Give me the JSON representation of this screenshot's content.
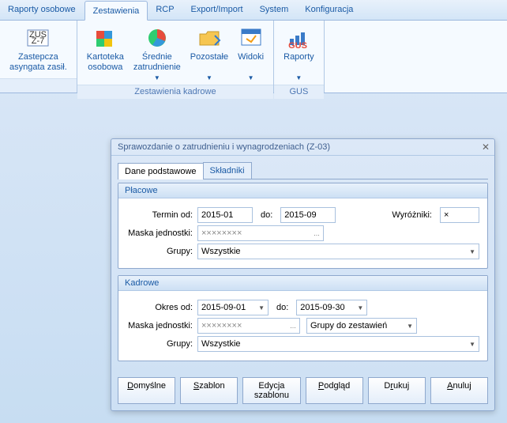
{
  "tabs": [
    "Raporty osobowe",
    "Zestawienia",
    "RCP",
    "Export/Import",
    "System",
    "Konfiguracja"
  ],
  "active_tab": 1,
  "ribbon": {
    "group1": {
      "label": "",
      "items": [
        {
          "label": "Zastepcza\nasyngata zasił."
        }
      ]
    },
    "group2": {
      "label": "Zestawienia kadrowe",
      "items": [
        {
          "label": "Kartoteka\nosobowa"
        },
        {
          "label": "Średnie\nzatrudnienie",
          "drop": true
        },
        {
          "label": "Pozostałe",
          "drop": true
        },
        {
          "label": "Widoki",
          "drop": true
        }
      ]
    },
    "group3": {
      "label": "GUS",
      "items": [
        {
          "label": "Raporty",
          "drop": true
        }
      ]
    }
  },
  "modal": {
    "title": "Sprawozdanie o zatrudnieniu i wynagrodzeniach (Z-03)",
    "tabs": [
      "Dane podstawowe",
      "Składniki"
    ],
    "active_tab": 0,
    "placowe": {
      "head": "Płacowe",
      "termin_od_label": "Termin od:",
      "termin_od": "2015-01",
      "do_label": "do:",
      "do": "2015-09",
      "wyrozniki_label": "Wyróżniki:",
      "wyrozniki": "×",
      "maska_label": "Maska jednostki:",
      "maska": "××××××××",
      "grupy_label": "Grupy:",
      "grupy": "Wszystkie"
    },
    "kadrowe": {
      "head": "Kadrowe",
      "okres_label": "Okres od:",
      "okres_od": "2015-09-01",
      "do_label": "do:",
      "okres_do": "2015-09-30",
      "maska_label": "Maska jednostki:",
      "maska": "××××××××",
      "grupy_do_label": "Grupy do zestawień",
      "grupy_label": "Grupy:",
      "grupy": "Wszystkie"
    },
    "buttons": {
      "domyslne": "Domyślne",
      "szablon": "Szablon",
      "edycja": "Edycja szablonu",
      "podglad": "Podgląd",
      "drukuj": "Drukuj",
      "anuluj": "Anuluj"
    }
  }
}
